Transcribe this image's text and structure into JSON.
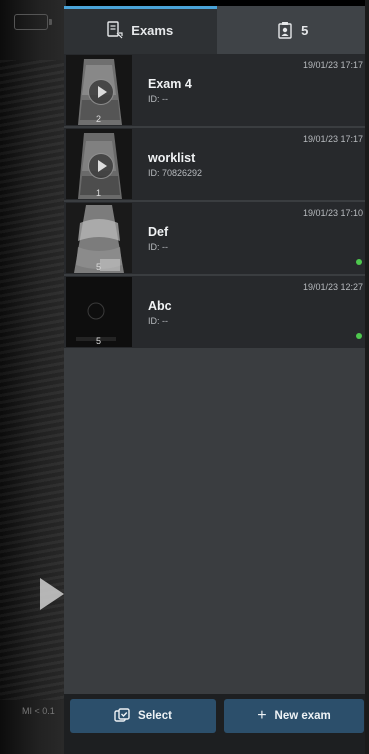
{
  "background": {
    "mi_label": "MI < 0.1"
  },
  "tabs": [
    {
      "label": "Exams",
      "icon": "exam-list-icon",
      "active": true
    },
    {
      "label": "5",
      "icon": "clipboard-patient-icon",
      "active": false
    }
  ],
  "exams": [
    {
      "name": "Exam 4",
      "id": "ID: --",
      "date": "19/01/23 17:17",
      "image_count": "2",
      "has_video": true,
      "status_dot": false
    },
    {
      "name": "worklist",
      "id": "ID: 70826292",
      "date": "19/01/23 17:17",
      "image_count": "1",
      "has_video": true,
      "status_dot": false
    },
    {
      "name": "Def",
      "id": "ID: --",
      "date": "19/01/23 17:10",
      "image_count": "5",
      "has_video": false,
      "status_dot": true
    },
    {
      "name": "Abc",
      "id": "ID: --",
      "date": "19/01/23 12:27",
      "image_count": "5",
      "has_video": false,
      "status_dot": true
    }
  ],
  "footer": {
    "select_label": "Select",
    "new_exam_label": "New exam"
  },
  "colors": {
    "accent": "#4aa3d8",
    "button": "#2c4f6b",
    "status_green": "#4ec84e"
  }
}
